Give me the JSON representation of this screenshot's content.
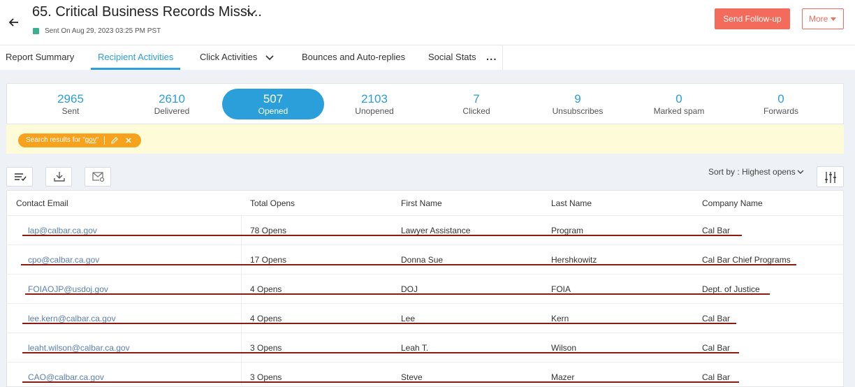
{
  "header": {
    "title": "65. Critical Business Records Missi...",
    "status": "Sent",
    "sent_on": "On Aug 29, 2023 03:25 PM PST",
    "followup_label": "Send Follow-up",
    "more_label": "More"
  },
  "tabs": [
    {
      "label": "Report Summary"
    },
    {
      "label": "Recipient Activities",
      "active": true
    },
    {
      "label": "Click Activities"
    },
    {
      "label": "Bounces and Auto-replies"
    },
    {
      "label": "Social Stats"
    }
  ],
  "tabs_more": "...",
  "stats": [
    {
      "num": "2965",
      "label": "Sent"
    },
    {
      "num": "2610",
      "label": "Delivered"
    },
    {
      "num": "507",
      "label": "Opened",
      "selected": true
    },
    {
      "num": "2103",
      "label": "Unopened"
    },
    {
      "num": "7",
      "label": "Clicked"
    },
    {
      "num": "9",
      "label": "Unsubscribes"
    },
    {
      "num": "0",
      "label": "Marked spam"
    },
    {
      "num": "0",
      "label": "Forwards"
    }
  ],
  "search_chip": {
    "prefix": "Search results for \"",
    "query": "gov",
    "suffix": "\""
  },
  "sort": {
    "label": "Sort by : Highest opens"
  },
  "table": {
    "columns": [
      "Contact Email",
      "Total Opens",
      "First Name",
      "Last Name",
      "Company Name"
    ],
    "rows": [
      {
        "email": "lap@calbar.ca.gov",
        "opens": "78 Opens",
        "first": "Lawyer Assistance",
        "last": "Program",
        "company": "Cal Bar"
      },
      {
        "email": "cpo@calbar.ca.gov",
        "opens": "17 Opens",
        "first": "Donna Sue",
        "last": "Hershkowitz",
        "company": "Cal Bar Chief Programs"
      },
      {
        "email": "FOIAOJP@usdoj.gov",
        "opens": "4 Opens",
        "first": "DOJ",
        "last": "FOIA",
        "company": "Dept. of Justice"
      },
      {
        "email": "lee.kern@calbar.ca.gov",
        "opens": "4 Opens",
        "first": "Lee",
        "last": "Kern",
        "company": "Cal Bar"
      },
      {
        "email": "leaht.wilson@calbar.ca.gov",
        "opens": "3 Opens",
        "first": "Leah T.",
        "last": "Wilson",
        "company": "Cal Bar"
      },
      {
        "email": "CAO@calbar.ca.gov",
        "opens": "3 Opens",
        "first": "Steve",
        "last": "Mazer",
        "company": "Cal Bar"
      }
    ]
  },
  "colors": {
    "accent": "#2b9fd9",
    "brand": "#f26b5b",
    "chip": "#f7a21d",
    "status": "#3bb08f",
    "annotation": "#8c1c13"
  },
  "icons": [
    "back-arrow-icon",
    "chevron-down-icon",
    "edit-pencil-icon",
    "close-icon",
    "list-filter-icon",
    "download-icon",
    "mail-settings-icon",
    "sliders-icon"
  ]
}
